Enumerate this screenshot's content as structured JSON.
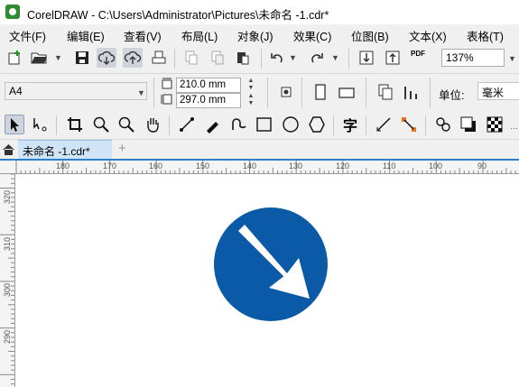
{
  "title_bar": {
    "title": "CorelDRAW - C:\\Users\\Administrator\\Pictures\\未命名 -1.cdr*"
  },
  "menu": [
    {
      "label": "文件(F)"
    },
    {
      "label": "编辑(E)"
    },
    {
      "label": "查看(V)"
    },
    {
      "label": "布局(L)"
    },
    {
      "label": "对象(J)"
    },
    {
      "label": "效果(C)"
    },
    {
      "label": "位图(B)"
    },
    {
      "label": "文本(X)"
    },
    {
      "label": "表格(T)"
    }
  ],
  "standard_toolbar": {
    "pdf_label": "PDF",
    "zoom_value": "137%"
  },
  "property_bar": {
    "page_size": "A4",
    "width": "210.0 mm",
    "height": "297.0 mm",
    "units_label": "单位:",
    "units_value": "毫米"
  },
  "tools": {
    "text_tool_glyph": "字"
  },
  "document_tab": {
    "label": "未命名 -1.cdr*",
    "add_label": "+"
  },
  "ruler": {
    "horizontal": [
      "180",
      "170",
      "160",
      "150",
      "140",
      "130",
      "120",
      "110",
      "100",
      "90"
    ],
    "vertical": [
      "320",
      "310",
      "300",
      "290"
    ]
  },
  "sign": {
    "color": "#0a5aa8",
    "arrow_color": "#ffffff"
  }
}
